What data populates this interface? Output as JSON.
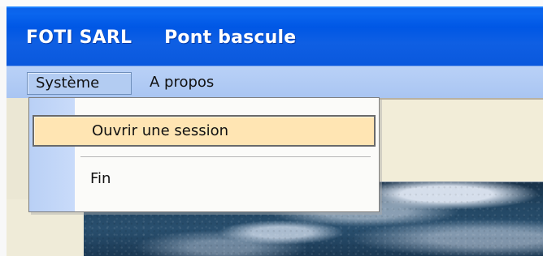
{
  "window": {
    "title_company": "FOTI SARL",
    "title_app": "Pont bascule"
  },
  "menubar": {
    "items": [
      {
        "label": "Système"
      },
      {
        "label": "A propos"
      }
    ]
  },
  "dropdown": {
    "items": [
      {
        "label": "Ouvrir une session"
      },
      {
        "label": "Fin"
      }
    ]
  }
}
